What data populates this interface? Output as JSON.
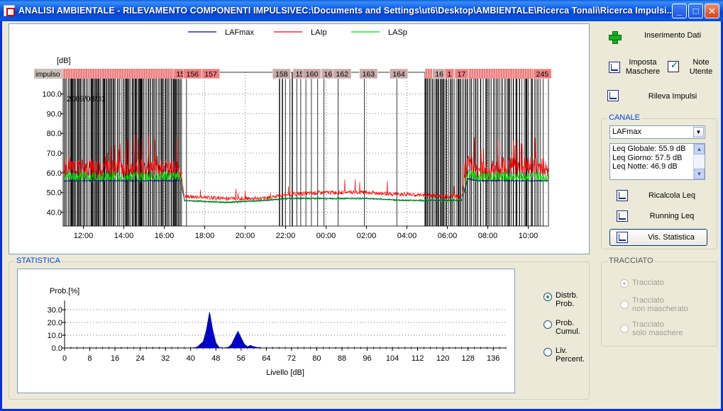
{
  "window": {
    "title": "ANALISI AMBIENTALE - RILEVAMENTO COMPONENTI IMPULSIVEC:\\Documents and Settings\\ut6\\Desktop\\AMBIENTALE\\Ricerca Tonali\\Ricerca Impulsi....",
    "minimize": "_",
    "maximize": "□",
    "close": "✕"
  },
  "toolbar": {
    "inserimento": "Inserimento Dati",
    "imposta_line1": "Imposta",
    "imposta_line2": "Maschere",
    "note_line1": "Note",
    "note_line2": "Utente",
    "rileva": "Rileva Impulsi"
  },
  "canale": {
    "title": "CANALE",
    "selected": "LAFmax",
    "leq": [
      "Leq Globale: 55.9 dB",
      "Leq Giorno: 57.5 dB",
      "Leq Notte: 46.9 dB"
    ],
    "ricalcola": "Ricalcola Leq",
    "running": "Running Leq",
    "statistica": "Vis. Statistica"
  },
  "statistica": {
    "title": "STATISTICA",
    "options": [
      {
        "line1": "Distrb.",
        "line2": "Prob.",
        "checked": true
      },
      {
        "line1": "Prob.",
        "line2": "Cumul.",
        "checked": false
      },
      {
        "line1": "Liv.",
        "line2": "Percent.",
        "checked": false
      }
    ]
  },
  "tracciato": {
    "title": "TRACCIATO",
    "options": [
      {
        "line1": "Tracciato",
        "line2": "",
        "checked": true
      },
      {
        "line1": "Tracciato",
        "line2": "non mascherato",
        "checked": false
      },
      {
        "line1": "Tracciato",
        "line2": "solo maschere",
        "checked": false
      }
    ]
  },
  "chart_data": [
    {
      "type": "line",
      "ylabel": "[dB]",
      "yticks": [
        "40.0",
        "50.0",
        "60.0",
        "70.0",
        "80.0",
        "90.0",
        "100.0"
      ],
      "ylim": [
        33,
        111
      ],
      "xticks": [
        "12:00",
        "14:00",
        "16:00",
        "18:00",
        "20:00",
        "22:00",
        "00:00",
        "02:00",
        "04:00",
        "06:00",
        "08:00",
        "10:00"
      ],
      "date_annotation": "2009/03/31",
      "legend": [
        {
          "name": "LAFmax",
          "color": "#000080"
        },
        {
          "name": "LAIp",
          "color": "#ff0000"
        },
        {
          "name": "LASp",
          "color": "#00dd00"
        }
      ],
      "impulse_label": "impulso",
      "impulse_tags": [
        {
          "label": "15",
          "hour": 16.8
        },
        {
          "label": "156",
          "hour": 17.4
        },
        {
          "label": "157",
          "hour": 18.3
        },
        {
          "label": "158",
          "hour": 21.8
        },
        {
          "label": "15",
          "hour": 22.7
        },
        {
          "label": "160",
          "hour": 23.3
        },
        {
          "label": "16",
          "hour": 24.1
        },
        {
          "label": "162",
          "hour": 24.8
        },
        {
          "label": "163",
          "hour": 26.1
        },
        {
          "label": "164",
          "hour": 27.6
        },
        {
          "label": "16",
          "hour": 29.6
        },
        {
          "label": "1",
          "hour": 30.1
        },
        {
          "label": "17",
          "hour": 30.7
        },
        {
          "label": "245",
          "hour": 34.7
        }
      ],
      "levels": {
        "hours": [
          11.0,
          16.8,
          17.0,
          19.0,
          21.0,
          22.0,
          24.0,
          26.0,
          28.0,
          30.0,
          30.7,
          31.0,
          31.5,
          32.0,
          33.0,
          34.0,
          35.0
        ],
        "LAFmax": [
          56,
          56,
          46,
          45,
          46,
          47,
          47,
          47,
          46,
          46,
          46,
          57,
          56,
          56,
          56,
          56,
          56
        ],
        "LAIp": [
          62,
          62,
          48,
          47,
          47,
          49,
          50,
          50,
          49,
          48,
          48,
          65,
          62,
          61,
          63,
          63,
          63
        ],
        "LASp": [
          58,
          58,
          46,
          45,
          46,
          47,
          47,
          47,
          46,
          46,
          46,
          59,
          58,
          58,
          58,
          58,
          58
        ]
      }
    },
    {
      "type": "area",
      "ylabel": "Prob.[%]",
      "xlabel": "Livello [dB]",
      "yticks": [
        "0.0",
        "10.0",
        "20.0",
        "30.0"
      ],
      "ylim": [
        0,
        35
      ],
      "xlim": [
        0,
        140
      ],
      "xticks": [
        "0",
        "8",
        "16",
        "24",
        "32",
        "40",
        "48",
        "56",
        "64",
        "72",
        "80",
        "88",
        "96",
        "104",
        "112",
        "120",
        "128",
        "136"
      ],
      "x": [
        40,
        42,
        44,
        45,
        46,
        47,
        48,
        49,
        50,
        52,
        53,
        54,
        55,
        56,
        57,
        58,
        59,
        60,
        61,
        62,
        63
      ],
      "values": [
        0,
        0.5,
        5,
        14,
        28,
        14,
        4,
        0.5,
        0,
        0.5,
        3,
        8,
        13,
        8,
        3,
        1,
        2,
        1,
        0.5,
        0.2,
        0
      ]
    }
  ]
}
